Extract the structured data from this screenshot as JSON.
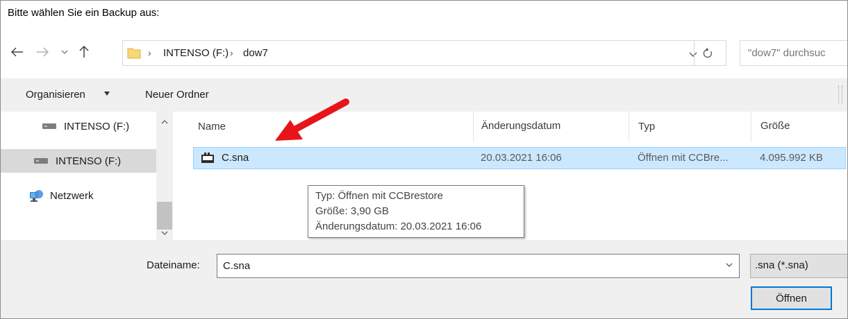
{
  "window": {
    "title": "Bitte wählen Sie ein Backup aus:"
  },
  "navigation": {
    "back_icon": "arrow-left-icon",
    "forward_icon": "arrow-right-icon",
    "recent_icon": "chevron-down-icon",
    "up_icon": "arrow-up-icon"
  },
  "address": {
    "crumbs": [
      "INTENSO (F:)",
      "dow7"
    ],
    "separator": "›",
    "refresh_icon": "refresh-icon"
  },
  "search": {
    "placeholder": "\"dow7\" durchsuc"
  },
  "toolbar": {
    "organize_label": "Organisieren",
    "new_folder_label": "Neuer Ordner"
  },
  "sidebar": {
    "items": [
      {
        "label": "INTENSO (F:)",
        "icon": "drive-icon",
        "selected": false
      },
      {
        "label": "INTENSO (F:)",
        "icon": "drive-icon",
        "selected": true
      },
      {
        "label": "Netzwerk",
        "icon": "network-icon",
        "selected": false
      }
    ]
  },
  "file_list": {
    "columns": [
      "Name",
      "Änderungsdatum",
      "Typ",
      "Größe"
    ],
    "rows": [
      {
        "name": "C.sna",
        "modified": "20.03.2021 16:06",
        "type": "Öffnen mit CCBre...",
        "size": "4.095.992 KB",
        "selected": true
      }
    ]
  },
  "tooltip": {
    "type_line": "Typ: Öffnen mit CCBrestore",
    "size_line": "Größe: 3,90 GB",
    "date_line": "Änderungsdatum: 20.03.2021 16:06"
  },
  "annotation": {
    "color": "#e8141b"
  },
  "footer": {
    "filename_label": "Dateiname:",
    "filename_value": "C.sna",
    "filter_label": ".sna (*.sna)",
    "open_button": "Öffnen"
  },
  "colors": {
    "selection_bg": "#cce8ff",
    "selection_border": "#99d1ff",
    "accent": "#0078d7",
    "toolbar_bg": "#f0f0f0"
  }
}
